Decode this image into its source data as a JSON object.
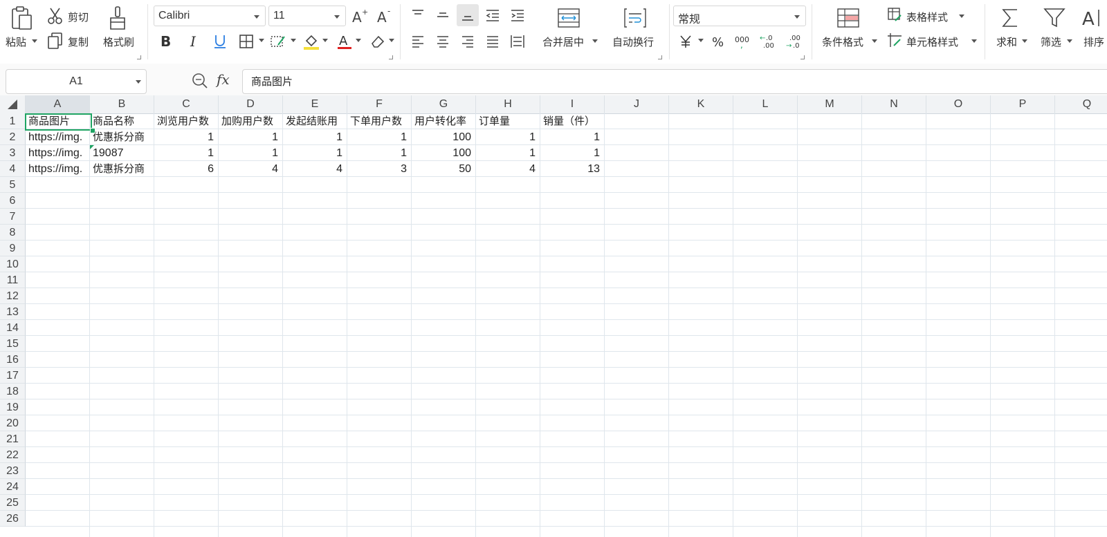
{
  "ribbon": {
    "paste_label": "粘贴",
    "cut_label": "剪切",
    "copy_label": "复制",
    "format_painter_label": "格式刷",
    "font_name": "Calibri",
    "font_size": "11",
    "merge_center_label": "合并居中",
    "wrap_text_label": "自动换行",
    "number_format": "常规",
    "conditional_format_label": "条件格式",
    "table_style_label": "表格样式",
    "cell_style_label": "单元格样式",
    "sum_label": "求和",
    "filter_label": "筛选",
    "sort_label": "排序",
    "accent_color": "#1fa463",
    "font_color": "#e02020",
    "fill_color": "#f5e03a"
  },
  "formula_bar": {
    "name_box": "A1",
    "fx_label": "fx",
    "content": "商品图片"
  },
  "sheet": {
    "columns": [
      "A",
      "B",
      "C",
      "D",
      "E",
      "F",
      "G",
      "H",
      "I",
      "J",
      "K",
      "L",
      "M",
      "N",
      "O",
      "P",
      "Q"
    ],
    "row_numbers": [
      "1",
      "2",
      "3",
      "4",
      "5",
      "6",
      "7",
      "8",
      "9",
      "10",
      "11",
      "12",
      "13",
      "14",
      "15",
      "16",
      "17",
      "18",
      "19",
      "20",
      "21",
      "22",
      "23",
      "24",
      "25",
      "26"
    ],
    "header_row": [
      "商品图片",
      "商品名称",
      "浏览用户数",
      "加购用户数",
      "发起结账用",
      "下单用户数",
      "用户转化率",
      "订单量",
      "销量（件）"
    ],
    "rows": [
      [
        "https://img.",
        "优惠拆分商",
        "1",
        "1",
        "1",
        "1",
        "100",
        "1",
        "1"
      ],
      [
        "https://img.",
        "19087",
        "1",
        "1",
        "1",
        "1",
        "100",
        "1",
        "1"
      ],
      [
        "https://img.",
        "优惠拆分商",
        "6",
        "4",
        "4",
        "3",
        "50",
        "4",
        "13"
      ]
    ]
  }
}
